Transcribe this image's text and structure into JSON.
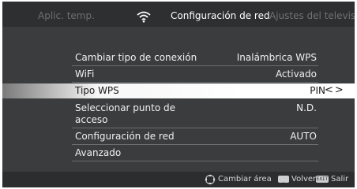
{
  "header": {
    "prev_tab": "Aplic. temp.",
    "current_tab": "Configuración de red",
    "next_tab": "Ajustes del televisor",
    "tab_icon": "wifi-icon"
  },
  "settings": {
    "connection_type": {
      "label": "Cambiar tipo de conexión",
      "value": "Inalámbrica WPS"
    },
    "wifi": {
      "label": "WiFi",
      "value": "Activado"
    },
    "wps_type": {
      "label": "Tipo WPS",
      "value": "PIN",
      "arrows": "<>"
    },
    "access_point": {
      "label": "Seleccionar punto de acceso",
      "value": "N.D."
    },
    "network_config": {
      "label": "Configuración de red",
      "value": "AUTO"
    },
    "advanced": {
      "label": "Avanzado"
    }
  },
  "footer": {
    "area_hint": "Cambiar área",
    "back_hint": "Volver",
    "exit_key": "EXIT",
    "exit_hint": "Salir",
    "area_icon": "dpad-icon",
    "back_icon": "back-key-icon"
  },
  "colors": {
    "background": "#3b3c3d",
    "bar_background": "#2e2f30",
    "highlight": "#ffffff",
    "text": "#f0f0f0"
  }
}
